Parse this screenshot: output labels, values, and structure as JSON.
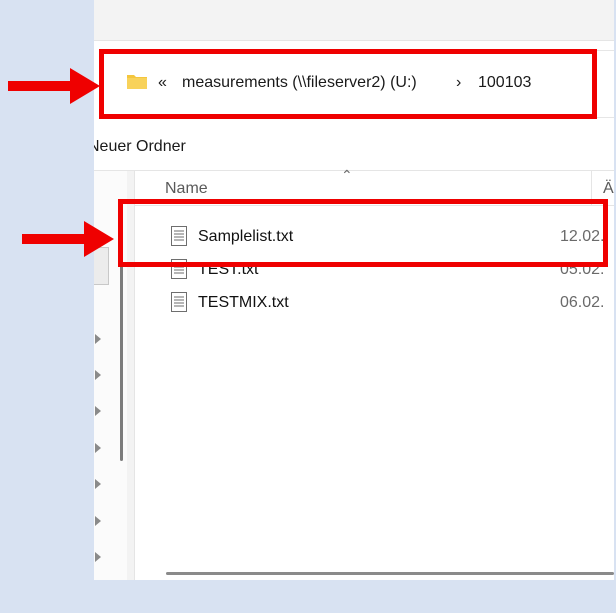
{
  "address_bar": {
    "overflow_chevron": "«",
    "crumbs": [
      "measurements (\\\\fileserver2) (U:)",
      "100103"
    ],
    "separator": "›",
    "folder_icon": "folder-icon"
  },
  "toolbar": {
    "new_folder_label": "Neuer Ordner"
  },
  "columns": {
    "name": "Name",
    "date": "Änder"
  },
  "files": [
    {
      "name": "Samplelist.txt",
      "date": "12.02."
    },
    {
      "name": "TEST.txt",
      "date": "05.02."
    },
    {
      "name": "TESTMIX.txt",
      "date": "06.02."
    }
  ],
  "annotations": {
    "color": "#ef0000"
  },
  "colors": {
    "background": "#d8e2f2",
    "window": "#ffffff",
    "folder": "#f4c63d"
  }
}
